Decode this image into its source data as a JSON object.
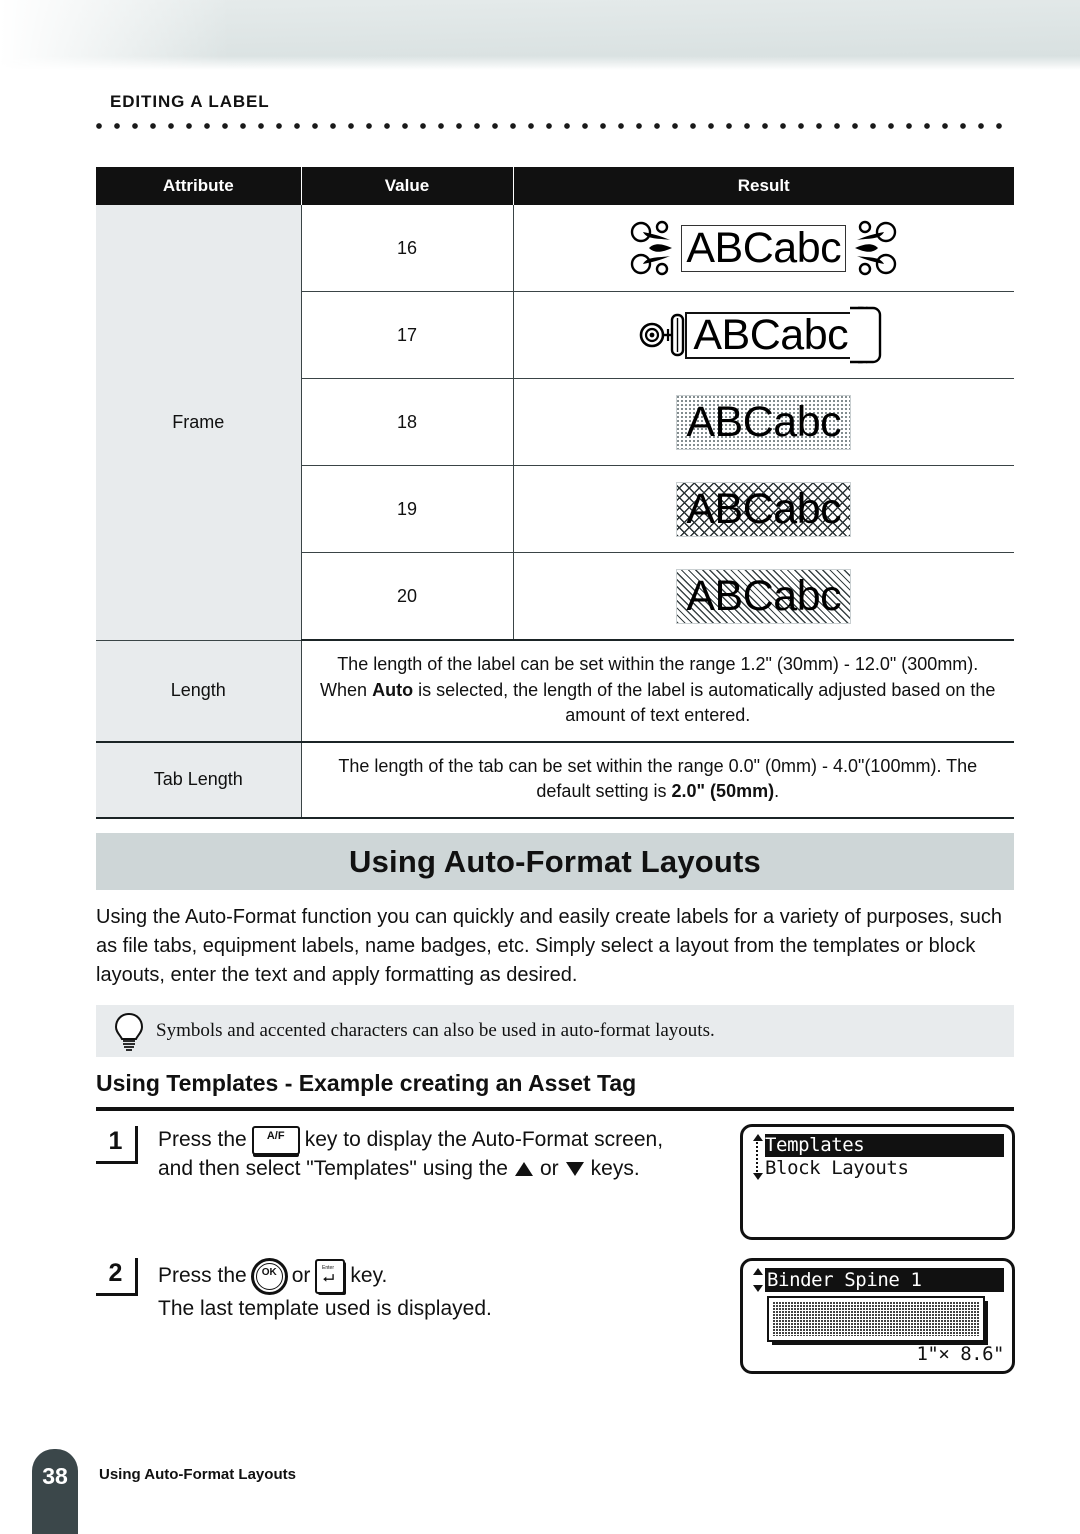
{
  "header": {
    "running_head": "EDITING A LABEL"
  },
  "table": {
    "columns": [
      "Attribute",
      "Value",
      "Result"
    ],
    "frame_attribute": "Frame",
    "frame_rows": [
      {
        "value": "16",
        "sample_text": "ABCabc",
        "style": "ornate"
      },
      {
        "value": "17",
        "sample_text": "ABCabc",
        "style": "tag-eyelet"
      },
      {
        "value": "18",
        "sample_text": "ABCabc",
        "style": "dotted-fill"
      },
      {
        "value": "19",
        "sample_text": "ABCabc",
        "style": "lattice-fill"
      },
      {
        "value": "20",
        "sample_text": "ABCabc",
        "style": "diagonal-fill"
      }
    ],
    "length_label": "Length",
    "length_desc_1": "The length of the label can be set within the range 1.2\" (30mm) - 12.0\" (300mm). When ",
    "length_desc_bold": "Auto",
    "length_desc_2": " is selected, the length of the label is automatically adjusted based on the amount of text entered.",
    "tab_length_label": "Tab Length",
    "tab_desc_1": "The length of the tab can be set within the range 0.0\" (0mm) - 4.0\"(100mm). The default setting is ",
    "tab_desc_bold": "2.0\" (50mm)",
    "tab_desc_2": "."
  },
  "section": {
    "banner_title": "Using Auto-Format Layouts",
    "intro": "Using the Auto-Format function you can quickly and easily create labels for a variety of purposes, such as file tabs, equipment labels, name badges, etc. Simply select a layout from the templates or block layouts, enter the text and apply formatting as desired.",
    "tip": "Symbols and accented characters can also be used in auto-format layouts.",
    "subheading": "Using Templates - Example creating an Asset Tag"
  },
  "steps": [
    {
      "number": "1",
      "text_before_key": "Press the ",
      "key_label": "A/F",
      "text_after_key": " key to display the Auto-Format screen,",
      "line2_before": "and then select \"Templates\" using the ",
      "line2_mid": " or ",
      "line2_after": " keys.",
      "screen": {
        "type": "list",
        "items": [
          {
            "label": "Templates",
            "selected": true
          },
          {
            "label": "Block Layouts",
            "selected": false
          }
        ]
      }
    },
    {
      "number": "2",
      "text_before_key": "Press the ",
      "key_ok": "OK",
      "text_mid": " or ",
      "key_enter": "Enter",
      "text_after_key": " key.",
      "line2": "The last template used is displayed.",
      "screen": {
        "type": "preview",
        "title": "Binder Spine 1",
        "dimensions": "1\"× 8.6\""
      }
    }
  ],
  "footer": {
    "page_number": "38",
    "chapter": "Using Auto-Format Layouts"
  }
}
